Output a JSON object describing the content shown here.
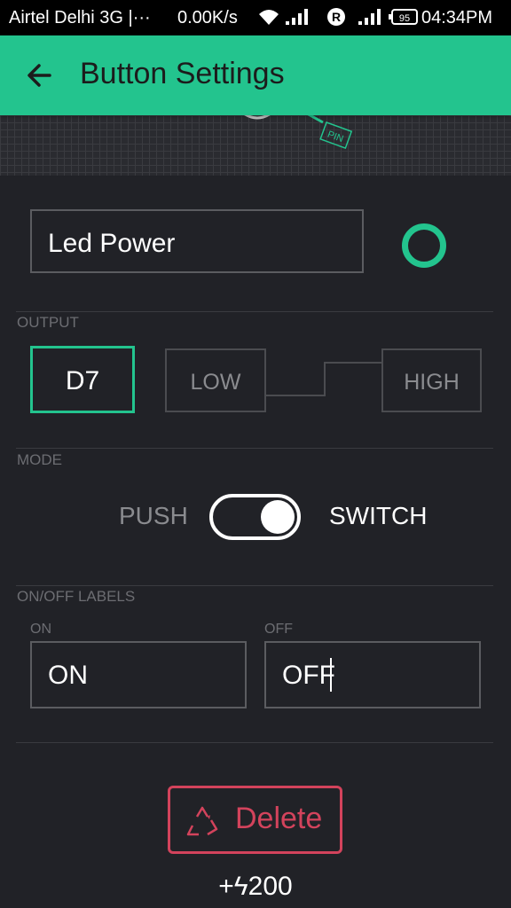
{
  "status_bar": {
    "carrier": "Airtel Delhi 3G |···",
    "speed": "0.00K/s",
    "battery": "95",
    "time": "04:34PM",
    "icons": [
      "wifi-icon",
      "signal-icon",
      "roaming-r-icon",
      "signal-icon",
      "battery-icon"
    ]
  },
  "app_bar": {
    "title": "Button Settings",
    "back_icon": "arrow-left-icon"
  },
  "widget_preview": {
    "tag": "PIN"
  },
  "name_field": {
    "value": "Led Power"
  },
  "color_picker": {
    "color": "#23c48e"
  },
  "output": {
    "label": "OUTPUT",
    "pin": "D7",
    "low": "LOW",
    "high": "HIGH"
  },
  "mode": {
    "label": "MODE",
    "push": "PUSH",
    "switch": "SWITCH",
    "selected": "SWITCH"
  },
  "labels": {
    "label": "ON/OFF LABELS",
    "on_label": "ON",
    "off_label": "OFF",
    "on_value": "ON",
    "off_value": "OFF"
  },
  "delete": {
    "label": "Delete",
    "icon": "recycle-icon"
  },
  "cost": {
    "text": "+ϟ200"
  },
  "colors": {
    "accent": "#23c48e",
    "danger": "#d3435c",
    "background": "#212227"
  }
}
